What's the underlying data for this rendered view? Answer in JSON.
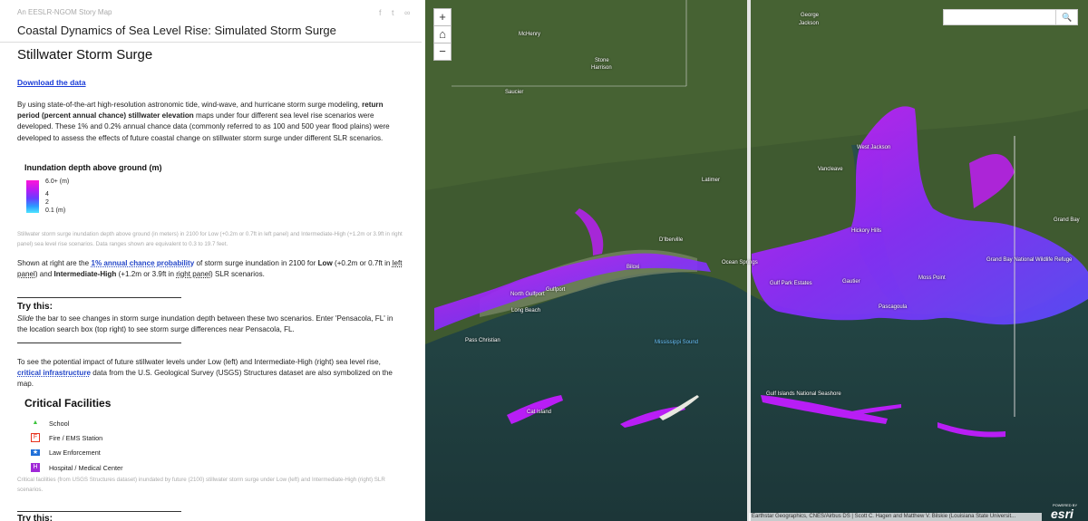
{
  "story": {
    "app_label": "An EESLR-NGOM Story Map",
    "title": "Coastal Dynamics of Sea Level Rise: Simulated Storm Surge"
  },
  "section": {
    "heading": "Stillwater Storm Surge",
    "download_link": "Download the data",
    "intro_p1_a": "By using state-of-the-art high-resolution astronomic tide, wind-wave, and hurricane storm surge modeling, ",
    "intro_p1_b": "return period (percent annual chance) stillwater elevation",
    "intro_p1_c": " maps under four different sea level rise scenarios were developed. These 1% and 0.2% annual chance data (commonly referred to as 100 and 500 year flood plains) were developed to assess the effects of future coastal change on stillwater storm surge under different SLR scenarios."
  },
  "legend": {
    "title": "Inundation depth above ground (m)",
    "labels": [
      "6.0+ (m)",
      "4",
      "2",
      "0.1 (m)"
    ],
    "colors": {
      "max": "#ff14d8",
      "mid": "#6a3cff",
      "min": "#4fe5ff"
    },
    "caption": "Stillwater storm surge inundation depth above ground (in meters) in 2100 for Low (+0.2m or 0.7ft in left panel) and Intermediate-High (+1.2m or 3.9ft in right panel) sea level rise scenarios. Data ranges shown are equivalent to 0.3 to 19.7 feet."
  },
  "shown": {
    "a": "Shown at right are the ",
    "link": "1% annual chance probability",
    "b": " of storm surge inundation in 2100 for ",
    "low": "Low",
    "c": " (+0.2m or 0.7ft in ",
    "left_panel": "left panel",
    "d": ") and ",
    "ih": "Intermediate-High",
    "e": " (+1.2m or 3.9ft in ",
    "right_panel": "right panel",
    "f": ") SLR scenarios."
  },
  "try1": {
    "heading": "Try this:",
    "slide": "Slide",
    "text": " the bar to see changes in storm surge inundation depth between these two scenarios. Enter 'Pensacola, FL' in the location search box (top right) to see storm surge differences near Pensacola, FL."
  },
  "infra": {
    "a": "To see the potential impact of future stillwater levels under Low (left) and Intermediate-High (right) sea level rise, ",
    "link": "critical infrastructure",
    "b": " data from the U.S. Geological Survey (USGS) Structures dataset are also symbolized on the map."
  },
  "facilities": {
    "title": "Critical Facilities",
    "items": [
      {
        "label": "School",
        "icon": "school-icon",
        "color": "#3cc43c",
        "glyph": "▲"
      },
      {
        "label": "Fire / EMS Station",
        "icon": "fire-station-icon",
        "color": "#e8321e",
        "glyph": "F"
      },
      {
        "label": "Law Enforcement",
        "icon": "law-enforcement-icon",
        "color": "#1f6fd8",
        "glyph": "★"
      },
      {
        "label": "Hospital / Medical Center",
        "icon": "hospital-icon",
        "color": "#a028d8",
        "glyph": "H"
      }
    ],
    "caption": "Critical facilities (from USGS Structures dataset) inundated by future (2100) stillwater storm surge under Low (left) and Intermediate-High (right) SLR scenarios."
  },
  "try2": {
    "heading": "Try this:"
  },
  "map": {
    "zoom_in": "+",
    "home": "⌂",
    "zoom_out": "−",
    "search_placeholder": "",
    "search_icon": "🔍",
    "attribution": "Earthstar Geographics, CNES/Airbus DS | Scott C. Hagen and Matthew V. Bilskie (Louisiana State Universit...",
    "powered_by": "POWERED BY",
    "esri": "esri",
    "labels": {
      "george": "George",
      "jackson": "Jackson",
      "mchenry": "McHenry",
      "stone": "Stone",
      "harrison": "Harrison",
      "saucier": "Saucier",
      "west_jackson": "West Jackson",
      "vancleave": "Vancleave",
      "latimer": "Latimer",
      "gautier": "Gautier",
      "moss_point": "Moss Point",
      "pascagoula": "Pascagoula",
      "hickory_hills": "Hickory Hills",
      "gulf_park": "Gulf Park Estates",
      "dhberville": "D'Iberville",
      "biloxi": "Biloxi",
      "ocean_springs": "Ocean Springs",
      "gulfport": "Gulfport",
      "long_beach": "Long Beach",
      "pass_christian": "Pass Christian",
      "mississippi_sound": "Mississippi Sound",
      "cat_island": "Cat Island",
      "grand_bay": "Grand Bay",
      "grand_bay_nwr": "Grand Bay National Wildlife Refuge",
      "gulf_islands": "Gulf Islands National Seashore",
      "north_gulfport": "North Gulfport"
    }
  }
}
